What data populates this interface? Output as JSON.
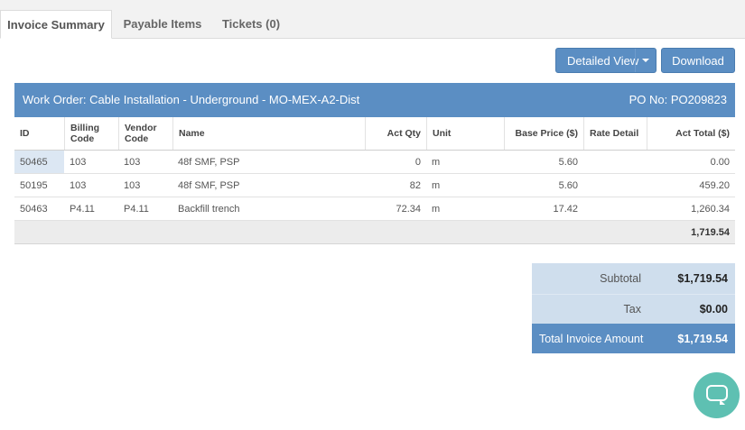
{
  "tabs": [
    {
      "label": "Invoice Summary",
      "active": true
    },
    {
      "label": "Payable Items",
      "active": false
    },
    {
      "label": "Tickets (0)",
      "active": false
    }
  ],
  "toolbar": {
    "detailed_view_label": "Detailed View",
    "download_label": "Download"
  },
  "work_order": {
    "title": "Work Order: Cable Installation - Underground - MO-MEX-A2-Dist",
    "po": "PO No: PO209823"
  },
  "table": {
    "headers": {
      "id": "ID",
      "billing_code": "Billing Code",
      "vendor_code": "Vendor Code",
      "name": "Name",
      "act_qty": "Act Qty",
      "unit": "Unit",
      "base_price": "Base Price ($)",
      "rate_detail": "Rate Detail",
      "act_total": "Act Total ($)"
    },
    "rows": [
      {
        "id": "50465",
        "billing_code": "103",
        "vendor_code": "103",
        "name": "48f SMF, PSP",
        "act_qty": "0",
        "unit": "m",
        "base_price": "5.60",
        "rate_detail": "",
        "act_total": "0.00"
      },
      {
        "id": "50195",
        "billing_code": "103",
        "vendor_code": "103",
        "name": "48f SMF, PSP",
        "act_qty": "82",
        "unit": "m",
        "base_price": "5.60",
        "rate_detail": "",
        "act_total": "459.20"
      },
      {
        "id": "50463",
        "billing_code": "P4.11",
        "vendor_code": "P4.11",
        "name": "Backfill trench",
        "act_qty": "72.34",
        "unit": "m",
        "base_price": "17.42",
        "rate_detail": "",
        "act_total": "1,260.34"
      }
    ],
    "footer_total": "1,719.54"
  },
  "summary": {
    "subtotal_label": "Subtotal",
    "subtotal": "$1,719.54",
    "tax_label": "Tax",
    "tax": "$0.00",
    "total_label": "Total Invoice Amount",
    "total": "$1,719.54"
  },
  "icons": {
    "chat": "chat-bubble-icon",
    "caret": "caret-down-icon"
  },
  "colors": {
    "accent": "#5b8ec3",
    "summary_bg": "#cfdeed",
    "chat": "#5ec0b2"
  }
}
